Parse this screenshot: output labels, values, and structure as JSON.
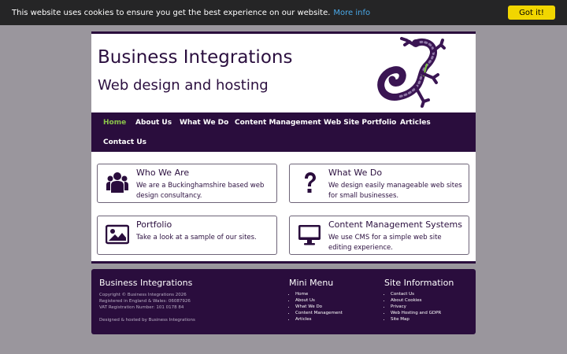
{
  "cookie": {
    "text": "This website uses cookies to ensure you get the best experience on our website.",
    "link": "More info",
    "button": "Got it!"
  },
  "header": {
    "title": "Business Integrations",
    "tagline": "Web design and hosting",
    "logo_icon": "gecko-logo"
  },
  "nav": {
    "items": [
      "Home",
      "About Us",
      "What We Do",
      "Content Management",
      "Web Site Portfolio",
      "Articles",
      "Contact Us"
    ],
    "active": "Home",
    "active_color": "#8bc34a"
  },
  "cards": [
    {
      "icon": "people-icon",
      "title": "Who We Are",
      "desc": "We are a Buckinghamshire based web design consultancy."
    },
    {
      "icon": "question-icon",
      "title": "What We Do",
      "desc": "We design easily manageable web sites for small businesses."
    },
    {
      "icon": "image-icon",
      "title": "Portfolio",
      "desc": "Take a look at a sample of our sites."
    },
    {
      "icon": "monitor-icon",
      "title": "Content Management Systems",
      "desc": "We use CMS for a simple web site editing experience."
    }
  ],
  "footer": {
    "company": {
      "title": "Business Integrations",
      "copyright": "Copyright © Business Integrations 2026",
      "registered": "Registered in England & Wales: 06087926",
      "vat": "VAT Registration Number: 101 0178 84",
      "designed": "Designed & hosted by Business Integrations"
    },
    "mini_menu": {
      "title": "Mini Menu",
      "items": [
        "Home",
        "About Us",
        "What We Do",
        "Content Management",
        "Articles"
      ]
    },
    "site_info": {
      "title": "Site Information",
      "items": [
        "Contact Us",
        "About Cookies",
        "Privacy",
        "Web Hosting and GDPR",
        "Site Map"
      ]
    }
  },
  "colors": {
    "brand_purple": "#2a0d3d",
    "cookie_button": "#f1d600",
    "link_blue": "#4aa8e8"
  }
}
